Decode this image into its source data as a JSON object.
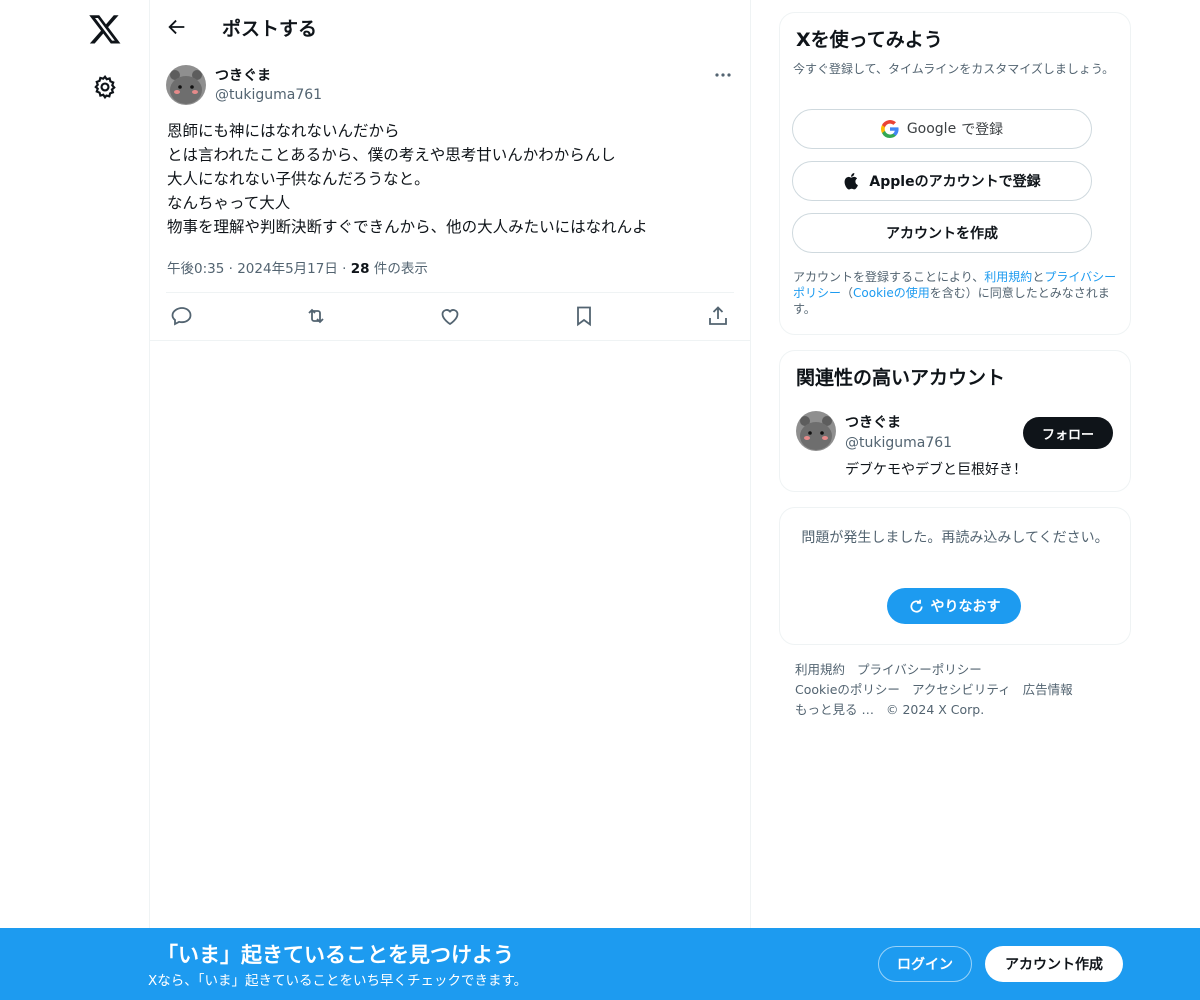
{
  "colors": {
    "accent": "#1d9bf0",
    "text": "#0f1419",
    "muted": "#536471",
    "border": "#eff3f4"
  },
  "nav": {
    "logo_icon": "x-logo-icon",
    "settings_icon": "gear-icon"
  },
  "header": {
    "back_icon": "arrow-left-icon",
    "title": "ポストする"
  },
  "post": {
    "author_name": "つきぐま",
    "author_handle": "@tukiguma761",
    "lines": [
      "恩師にも神にはなれないんだから",
      "とは言われたことあるから、僕の考えや思考甘いんかわからんし",
      "大人になれない子供なんだろうなと。",
      "なんちゃって大人",
      "物事を理解や判断決断すぐできんから、他の大人みたいにはなれんよ"
    ],
    "time": "午後0:35",
    "date": "2024年5月17日",
    "views": "28",
    "views_label": "件の表示",
    "actions": [
      "reply-icon",
      "repost-icon",
      "like-icon",
      "bookmark-icon",
      "share-icon"
    ]
  },
  "signup": {
    "title": "Xを使ってみよう",
    "subtitle": "今すぐ登録して、タイムラインをカスタマイズしましょう。",
    "google_brand": "Google",
    "google_label": "で登録",
    "apple_label": "Appleのアカウントで登録",
    "create_label": "アカウントを作成",
    "legal_1": "アカウントを登録することにより、",
    "legal_terms": "利用規約",
    "legal_and": "と",
    "legal_privacy": "プライバシーポリシー",
    "legal_paren_open": "（",
    "legal_cookie": "Cookieの使用",
    "legal_2": "を含む）に同意したとみなされます。"
  },
  "related": {
    "title": "関連性の高いアカウント",
    "name": "つきぐま",
    "handle": "@tukiguma761",
    "bio": "デブケモやデブと巨根好き！",
    "follow_label": "フォロー"
  },
  "error": {
    "message": "問題が発生しました。再読み込みしてください。",
    "retry_label": "やりなおす"
  },
  "footer": {
    "links": [
      "利用規約",
      "プライバシーポリシー",
      "Cookieのポリシー",
      "アクセシビリティ",
      "広告情報",
      "もっと見る …",
      "© 2024 X Corp."
    ]
  },
  "bottom_bar": {
    "title": "「いま」起きていることを見つけよう",
    "subtitle": "Xなら、「いま」起きていることをいち早くチェックできます。",
    "login_label": "ログイン",
    "create_label": "アカウント作成"
  }
}
